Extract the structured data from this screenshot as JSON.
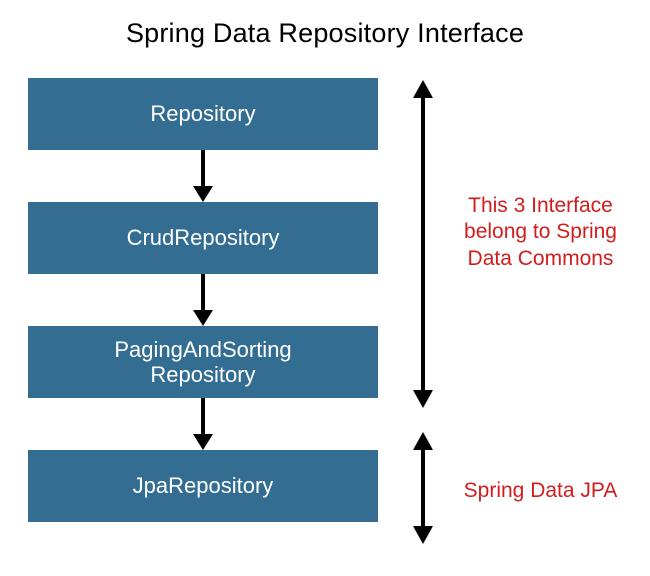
{
  "title": "Spring Data Repository Interface",
  "boxes": {
    "repository": "Repository",
    "crud": "CrudRepository",
    "paging": "PagingAndSorting\nRepository",
    "jpa": "JpaRepository"
  },
  "annotations": {
    "commons": "This 3 Interface belong to Spring Data Commons",
    "jpa": "Spring Data JPA"
  },
  "colors": {
    "box_bg": "#336d92",
    "box_fg": "#ffffff",
    "annotation": "#d31c1c",
    "arrow": "#000000"
  }
}
